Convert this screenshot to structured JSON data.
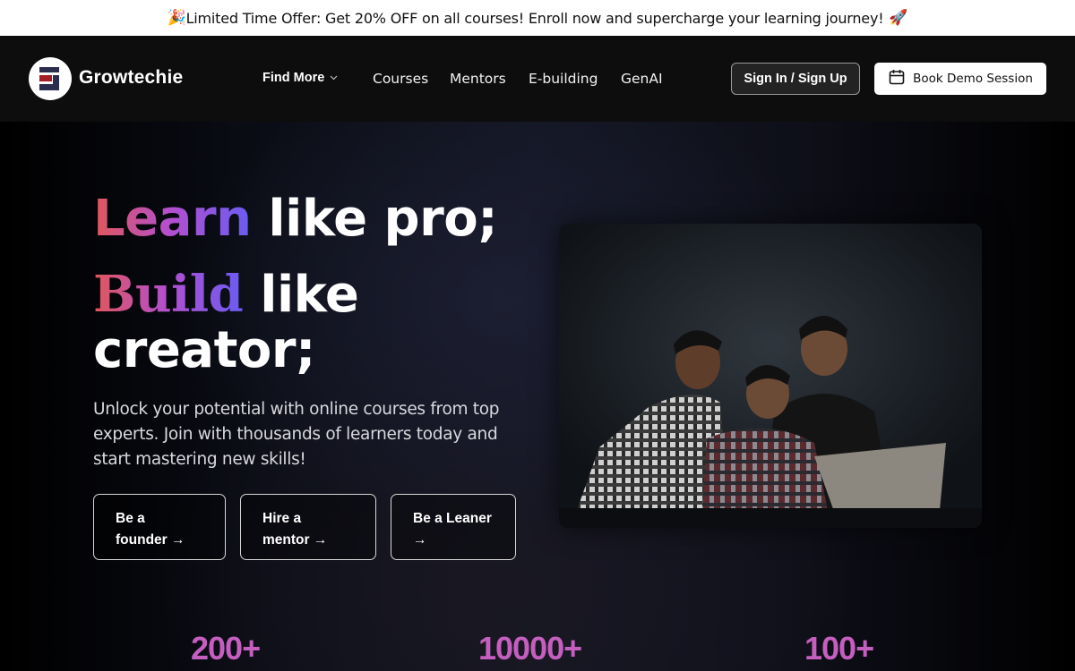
{
  "promo": {
    "icon_left": "party-popper-icon",
    "emoji_left": "🎉",
    "text": "Limited Time Offer: Get 20% OFF on all courses! Enroll now and supercharge your learning journey!",
    "icon_right": "rocket-icon",
    "emoji_right": "🚀"
  },
  "nav": {
    "brand": "Growtechie",
    "find_more": "Find More",
    "chevron": "⌄",
    "links": [
      "Courses",
      "Mentors",
      "E-building",
      "GenAI"
    ],
    "signin_label": "Sign In / Sign Up",
    "demo_label": "Book Demo Session"
  },
  "hero": {
    "line1_accent": "Learn",
    "line1_rest": " like pro;",
    "line2_accent": "Build",
    "line2_rest": " like",
    "line3": "creator;",
    "subtitle": "Unlock your potential with online courses from top experts. Join with thousands of learners today and start mastering new skills!",
    "ctas": [
      {
        "line1": "Be a",
        "line2": "founder →"
      },
      {
        "line1": "Hire a",
        "line2": "mentor →"
      },
      {
        "line1": "Be a Leaner",
        "line2": "→"
      }
    ],
    "image_alt": "Three young men looking at a laptop against a dark chalkboard background"
  },
  "stats": [
    "200+",
    "10000+",
    "100+"
  ],
  "colors": {
    "accent_gradient_start": "#e0575a",
    "accent_gradient_mid": "#b24fd0",
    "accent_gradient_end": "#6a5cf2",
    "stat_color": "#c45fbf",
    "navbar_bg": "#0d0d0d",
    "promo_bg": "#ffffff"
  }
}
